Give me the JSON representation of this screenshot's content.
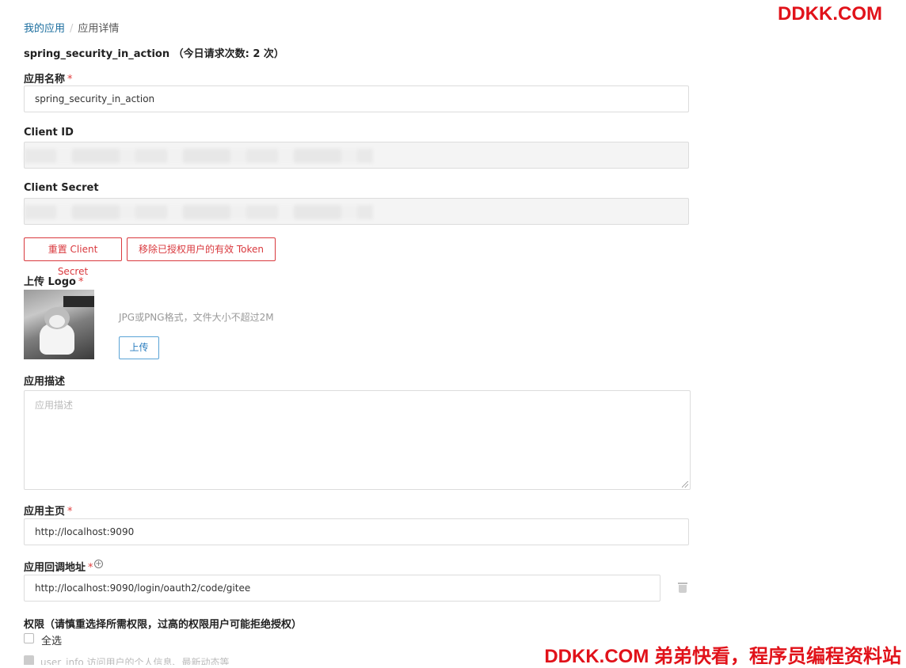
{
  "watermark": {
    "top": "DDKK.COM",
    "bottom": "DDKK.COM 弟弟快看，程序员编程资料站"
  },
  "breadcrumb": {
    "items": [
      {
        "label": "我的应用"
      },
      {
        "label": "应用详情"
      }
    ],
    "separator": "/"
  },
  "app": {
    "title": "spring_security_in_action （今日请求次数: 2 次）"
  },
  "form": {
    "name": {
      "label": "应用名称",
      "required": "*",
      "value": "spring_security_in_action"
    },
    "client_id": {
      "label": "Client ID"
    },
    "client_secret": {
      "label": "Client Secret"
    },
    "reset_secret_button": "重置 Client Secret",
    "revoke_tokens_button": "移除已授权用户的有效 Token",
    "logo": {
      "label": "上传 Logo",
      "required": "*",
      "hint": "JPG或PNG格式，文件大小不超过2M",
      "upload_button": "上传"
    },
    "description": {
      "label": "应用描述",
      "placeholder": "应用描述"
    },
    "homepage": {
      "label": "应用主页",
      "required": "*",
      "value": "http://localhost:9090"
    },
    "callback": {
      "label": "应用回调地址",
      "required": "*",
      "value": "http://localhost:9090/login/oauth2/code/gitee"
    },
    "permissions": {
      "label": "权限（请慎重选择所需权限，过高的权限用户可能拒绝授权）",
      "select_all": "全选",
      "first_item_partial": "user_info        访问用户的个人信息、最新动态等"
    }
  },
  "colors": {
    "accent_red": "#d9393e",
    "link_blue": "#1a6d9e",
    "watermark_red": "#e1121a"
  }
}
